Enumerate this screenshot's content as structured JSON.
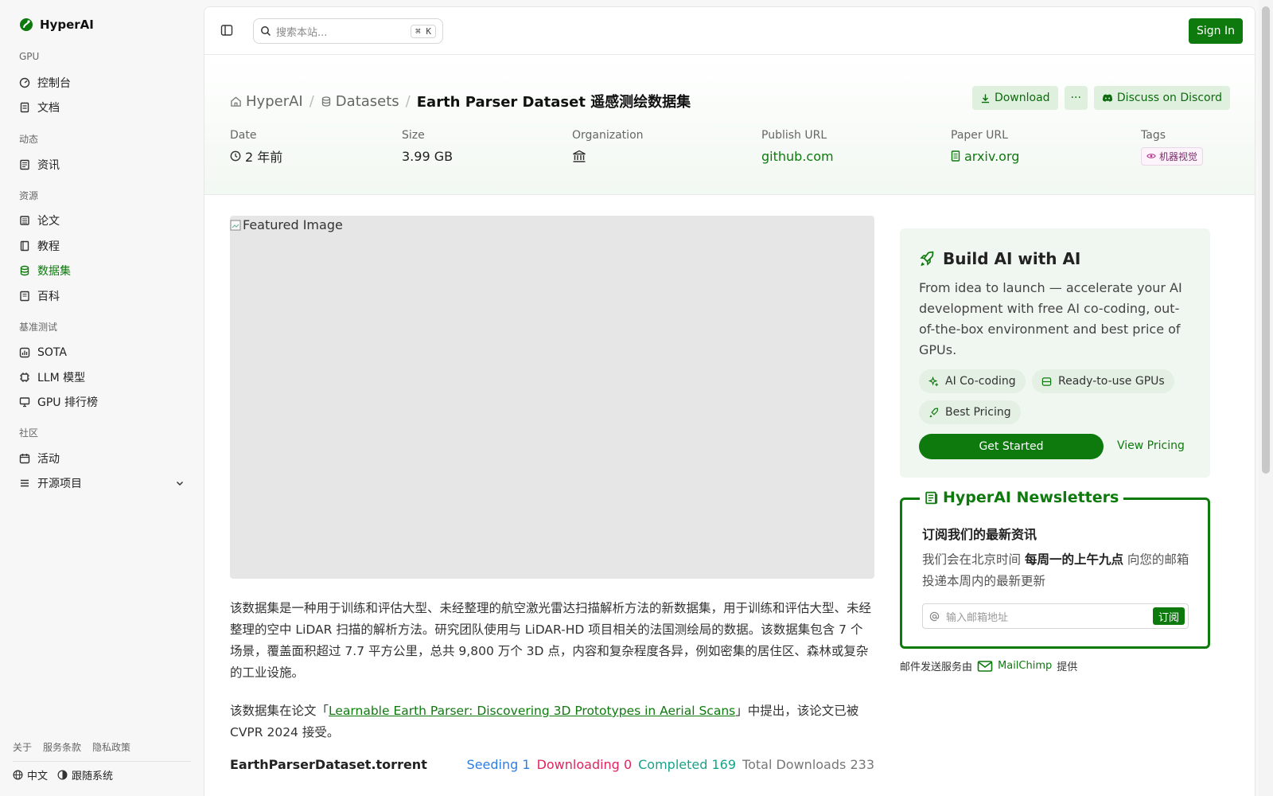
{
  "brand": {
    "name": "HyperAI",
    "color": "#0e7a0e"
  },
  "sidebar": {
    "sections": [
      {
        "label": "GPU",
        "items": [
          {
            "label": "控制台",
            "icon": "gauge-icon"
          },
          {
            "label": "文档",
            "icon": "doc-icon"
          }
        ]
      },
      {
        "label": "动态",
        "items": [
          {
            "label": "资讯",
            "icon": "news-icon"
          }
        ]
      },
      {
        "label": "资源",
        "items": [
          {
            "label": "论文",
            "icon": "paper-icon"
          },
          {
            "label": "教程",
            "icon": "book-icon"
          },
          {
            "label": "数据集",
            "icon": "database-icon",
            "active": true
          },
          {
            "label": "百科",
            "icon": "wiki-icon"
          }
        ]
      },
      {
        "label": "基准测试",
        "items": [
          {
            "label": "SOTA",
            "icon": "chart-icon"
          },
          {
            "label": "LLM 模型",
            "icon": "chip-icon"
          },
          {
            "label": "GPU 排行榜",
            "icon": "monitor-icon"
          }
        ]
      },
      {
        "label": "社区",
        "items": [
          {
            "label": "活动",
            "icon": "calendar-icon"
          },
          {
            "label": "开源项目",
            "icon": "list-icon",
            "expandable": true
          }
        ]
      }
    ],
    "footer_links": [
      "关于",
      "服务条款",
      "隐私政策"
    ],
    "language": "中文",
    "theme": "跟随系统"
  },
  "topbar": {
    "search_placeholder": "搜索本站...",
    "shortcut": "⌘ K",
    "sign_in": "Sign In"
  },
  "breadcrumb": {
    "home": "HyperAI",
    "section": "Datasets",
    "current": "Earth Parser Dataset 遥感测绘数据集"
  },
  "actions": {
    "download": "Download",
    "more": "···",
    "discord": "Discuss on Discord"
  },
  "meta": {
    "date": {
      "label": "Date",
      "value": "2 年前"
    },
    "size": {
      "label": "Size",
      "value": "3.99 GB"
    },
    "organization": {
      "label": "Organization",
      "icon": "bank-icon"
    },
    "publish_url": {
      "label": "Publish URL",
      "value": "github.com"
    },
    "paper_url": {
      "label": "Paper URL",
      "value": "arxiv.org"
    },
    "tags": {
      "label": "Tags",
      "value": "机器视觉"
    }
  },
  "featured_alt": "Featured Image",
  "description": "该数据集是一种用于训练和评估大型、未经整理的航空激光雷达扫描解析方法的新数据集，用于训练和评估大型、未经整理的空中 LiDAR 扫描的解析方法。研究团队使用与 LiDAR-HD 项目相关的法国测绘局的数据。该数据集包含 7 个场景，覆盖面积超过 7.7 平方公里，总共 9,800 万个 3D 点，内容和复杂程度各异，例如密集的居住区、森林或复杂的工业设施。",
  "paper_note": {
    "before": "该数据集在论文「",
    "link": "Learnable Earth Parser: Discovering 3D Prototypes in Aerial Scans",
    "after": "」中提出，该论文已被 CVPR 2024 接受。"
  },
  "torrent": {
    "name": "EarthParserDataset.torrent",
    "seeding_label": "Seeding",
    "seeding": "1",
    "downloading_label": "Downloading",
    "downloading": "0",
    "completed_label": "Completed",
    "completed": "169",
    "total_label": "Total Downloads",
    "total": "233"
  },
  "promo": {
    "title": "Build AI with AI",
    "text": "From idea to launch — accelerate your AI development with free AI co-coding, out-of-the-box environment and best price of GPUs.",
    "chips": [
      "AI Co-coding",
      "Ready-to-use GPUs",
      "Best Pricing"
    ],
    "cta": "Get Started",
    "secondary": "View Pricing"
  },
  "newsletter": {
    "title": "HyperAI Newsletters",
    "heading": "订阅我们的最新资讯",
    "text_before": "我们会在北京时间 ",
    "text_bold": "每周一的上午九点",
    "text_after": " 向您的邮箱投递本周内的最新更新",
    "email_placeholder": "输入邮箱地址",
    "subscribe": "订阅",
    "provider_before": "邮件发送服务由",
    "provider": "MailChimp",
    "provider_after": "提供"
  }
}
